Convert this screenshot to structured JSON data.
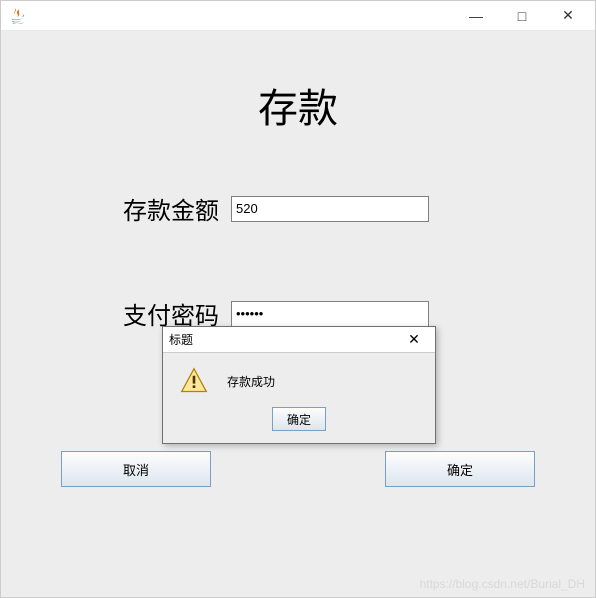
{
  "titlebar": {
    "minimize": "—",
    "maximize": "□",
    "close": "✕"
  },
  "page": {
    "title": "存款"
  },
  "form": {
    "amount_label": "存款金额",
    "amount_value": "520",
    "password_label": "支付密码",
    "password_value": "••••••"
  },
  "buttons": {
    "cancel": "取消",
    "confirm": "确定"
  },
  "dialog": {
    "title": "标题",
    "close": "✕",
    "message": "存款成功",
    "ok": "确定"
  },
  "watermark": "https://blog.csdn.net/Burial_DH"
}
